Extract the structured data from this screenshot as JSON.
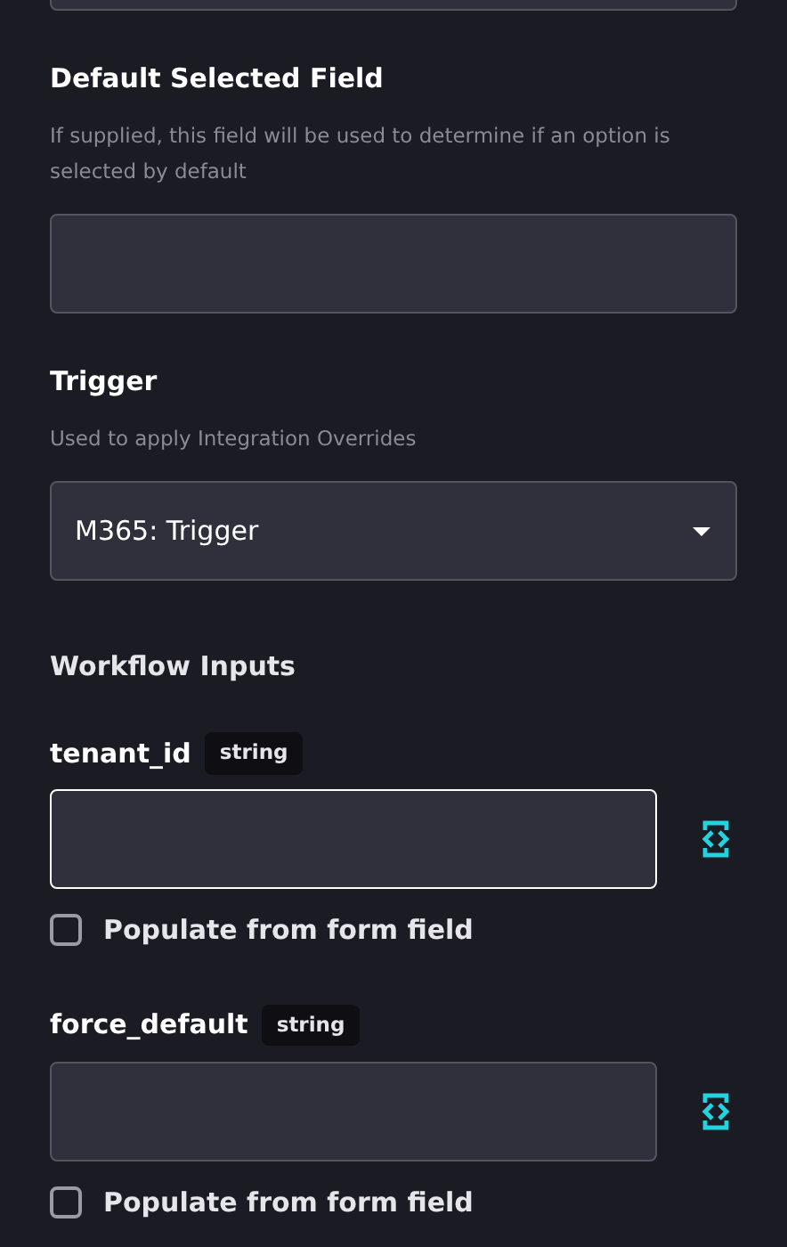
{
  "fields": [
    {
      "label": "Default Selected Field",
      "help": "If supplied, this field will be used to determine if an option is selected by default",
      "kind": "text"
    },
    {
      "label": "Trigger",
      "help": "Used to apply Integration Overrides",
      "kind": "select",
      "value": "M365: Trigger"
    }
  ],
  "workflow_inputs": {
    "title": "Workflow Inputs",
    "inputs": [
      {
        "name": "tenant_id",
        "type": "string",
        "focused": true,
        "populate_from_form_field": {
          "label": "Populate from form field",
          "checked": false
        }
      },
      {
        "name": "force_default",
        "type": "string",
        "focused": false,
        "populate_from_form_field": {
          "label": "Populate from form field",
          "checked": false
        }
      }
    ]
  }
}
